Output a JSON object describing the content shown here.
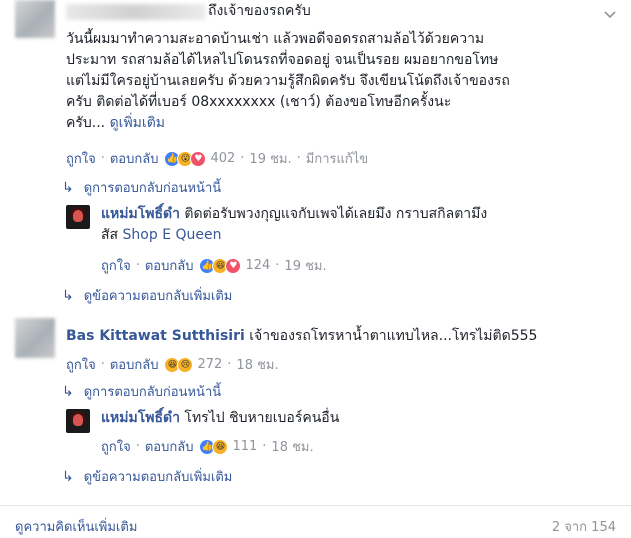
{
  "comment1": {
    "name_visible": "ถึงเจ้าของรถครับ",
    "text_lines": [
      "วันนี้ผมมาทำความสะอาดบ้านเช่า แล้วพอดีจอดรถสามล้อไว้ด้วยความ",
      "ประมาท รถสามล้อได้ไหลไปโดนรถที่จอดอยู่ จนเป็นรอย ผมอยากขอโทษ",
      "แต่ไม่มีใครอยู่บ้านเลยครับ ด้วยความรู้สึกผิดครับ จึงเขียนโน้ตถึงเจ้าของรถ",
      "ครับ ติดต่อได้ที่เบอร์ 08xxxxxxxx (เชาว์) ต้องขอโทษอีกครั้งนะ",
      "ครับ..."
    ],
    "see_more": "ดูเพิ่มเติม",
    "like": "ถูกใจ",
    "reply": "ตอบกลับ",
    "reaction_count": "402",
    "time": "19 ชม.",
    "edited": "มีการแก้ไข",
    "prev_replies": "ดูการตอบกลับก่อนหน้านี้",
    "reply1": {
      "name": "แหม่มโพธิ์ดำ",
      "text_line1": "ติดต่อรับพวงกุญแจกับเพจได้เลยมึง กราบสกิลตามึง",
      "text_line2_prefix": "สัส ",
      "tag": "Shop E Queen",
      "like": "ถูกใจ",
      "reply": "ตอบกลับ",
      "reaction_count": "124",
      "time": "19 ชม."
    },
    "more_replies": "ดูข้อความตอบกลับเพิ่มเติม"
  },
  "comment2": {
    "name": "Bas Kittawat Sutthisiri",
    "text": "เจ้าของรถโทรหาน้ำตาแทบไหล...โทรไม่ติด555",
    "like": "ถูกใจ",
    "reply": "ตอบกลับ",
    "reaction_count": "272",
    "time": "18 ชม.",
    "prev_replies": "ดูการตอบกลับก่อนหน้านี้",
    "reply1": {
      "name": "แหม่มโพธิ์ดำ",
      "text": "โทรไป ชิบหายเบอร์คนอื่น",
      "like": "ถูกใจ",
      "reply": "ตอบกลับ",
      "reaction_count": "111",
      "time": "18 ชม."
    },
    "more_replies": "ดูข้อความตอบกลับเพิ่มเติม"
  },
  "footer": {
    "view_more": "ดูความคิดเห็นเพิ่มเติม",
    "count": "2 จาก 154"
  },
  "colors": {
    "link": "#365899",
    "muted": "#90949c",
    "like": "#4080ff"
  }
}
